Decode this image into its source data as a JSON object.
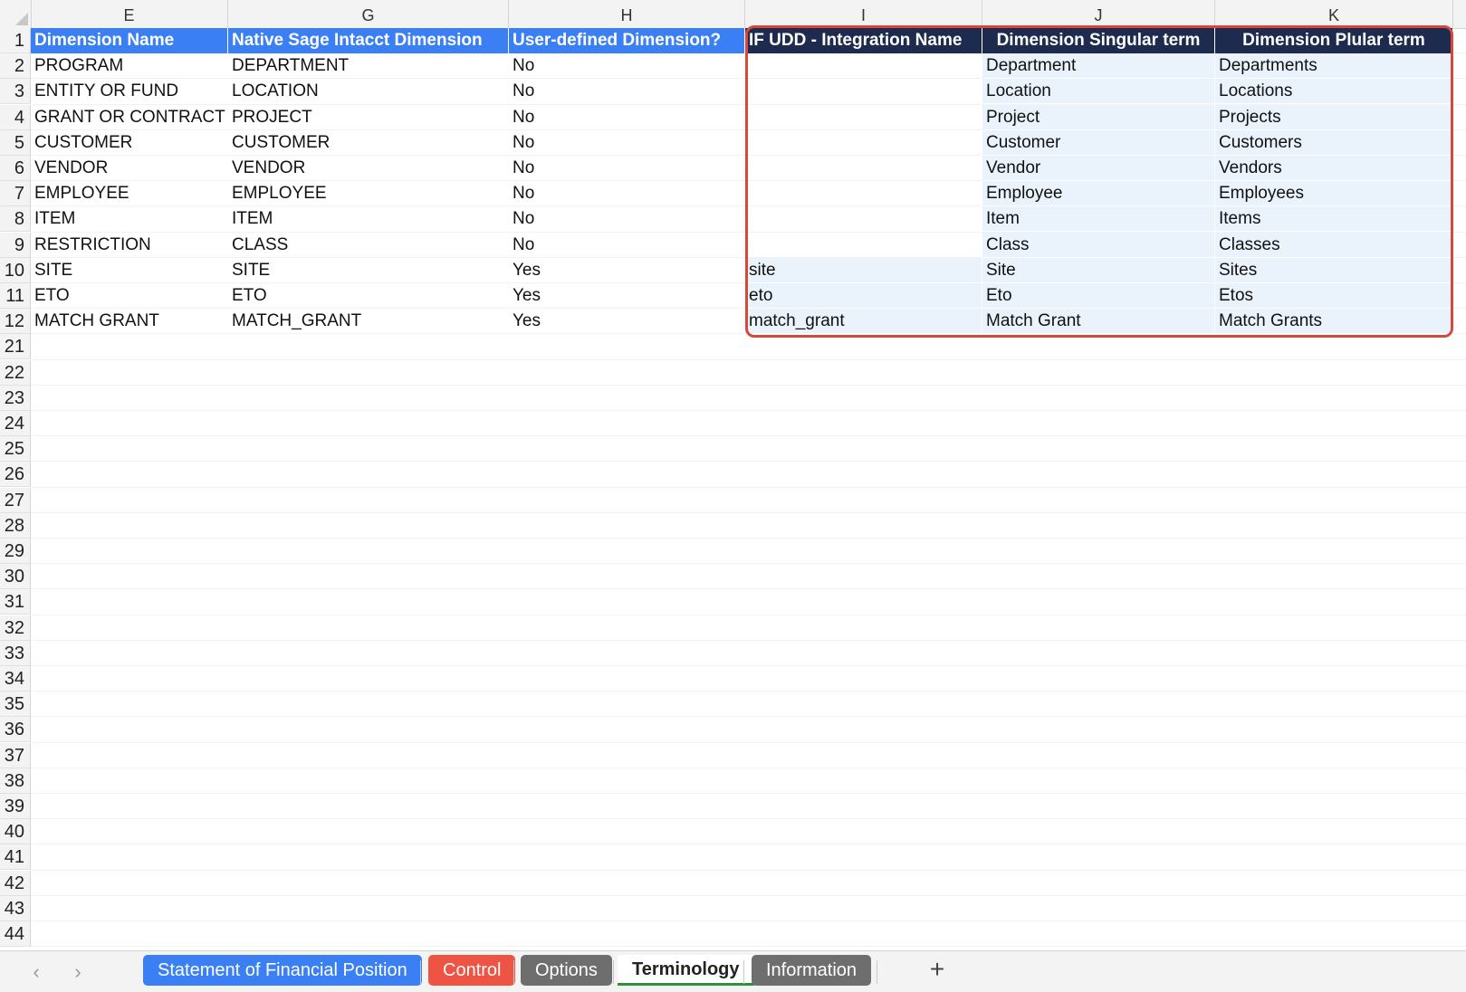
{
  "app": {
    "name": "spreadsheet"
  },
  "colors": {
    "header_blue": "#3b7ff5",
    "header_dark": "#1d2b4f",
    "tint": "#eaf3fc",
    "highlight": "#d9463a"
  },
  "columns": [
    "E",
    "G",
    "H",
    "I",
    "J",
    "K"
  ],
  "row_numbers": [
    "1",
    "2",
    "3",
    "4",
    "5",
    "6",
    "7",
    "8",
    "9",
    "10",
    "11",
    "12",
    "21",
    "22",
    "23",
    "24",
    "25",
    "26",
    "27",
    "28",
    "29",
    "30",
    "31",
    "32",
    "33",
    "34",
    "35",
    "36",
    "37",
    "38",
    "39",
    "40",
    "41",
    "42",
    "43",
    "44"
  ],
  "headers": [
    "Dimension Name",
    "Native Sage Intacct Dimension",
    "User-defined Dimension?",
    "IF UDD - Integration Name",
    "Dimension Singular term",
    "Dimension Plular term"
  ],
  "rows": [
    [
      "PROGRAM",
      "DEPARTMENT",
      "No",
      "",
      "Department",
      "Departments"
    ],
    [
      "ENTITY OR FUND",
      "LOCATION",
      "No",
      "",
      "Location",
      "Locations"
    ],
    [
      "GRANT OR CONTRACT",
      "PROJECT",
      "No",
      "",
      "Project",
      "Projects"
    ],
    [
      "CUSTOMER",
      "CUSTOMER",
      "No",
      "",
      "Customer",
      "Customers"
    ],
    [
      "VENDOR",
      "VENDOR",
      "No",
      "",
      "Vendor",
      "Vendors"
    ],
    [
      "EMPLOYEE",
      "EMPLOYEE",
      "No",
      "",
      "Employee",
      "Employees"
    ],
    [
      "ITEM",
      "ITEM",
      "No",
      "",
      "Item",
      "Items"
    ],
    [
      "RESTRICTION",
      "CLASS",
      "No",
      "",
      "Class",
      "Classes"
    ],
    [
      "SITE",
      "SITE",
      "Yes",
      "site",
      "Site",
      "Sites"
    ],
    [
      "ETO",
      "ETO",
      "Yes",
      "eto",
      "Eto",
      "Etos"
    ],
    [
      "MATCH GRANT",
      "MATCH_GRANT",
      "Yes",
      "match_grant",
      "Match Grant",
      "Match Grants"
    ]
  ],
  "tabs": {
    "prev_icon": "‹",
    "next_icon": "›",
    "items": [
      {
        "label": "Statement of Financial Position",
        "color": "#3b7ff5"
      },
      {
        "label": "Control",
        "color": "#ee5443"
      },
      {
        "label": "Options",
        "color": "#6e6e6e"
      },
      {
        "label": "Terminology",
        "active": true
      },
      {
        "label": "Information",
        "color": "#6e6e6e"
      }
    ],
    "add_icon": "+"
  }
}
